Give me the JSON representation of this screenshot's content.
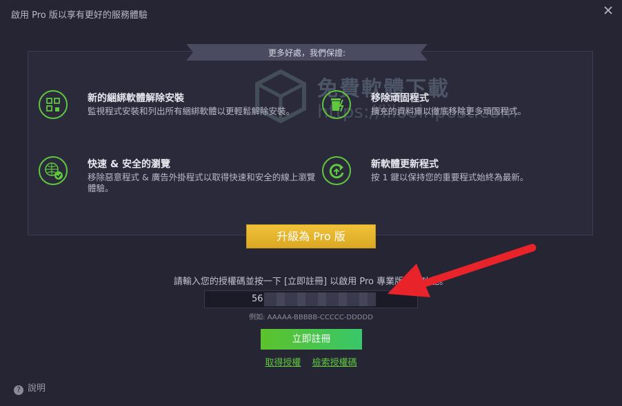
{
  "window": {
    "title": "啟用 Pro 版以享有更好的服務體驗",
    "close_icon": "close-icon"
  },
  "panel": {
    "ribbon": "更多好處，我們保證:",
    "features": [
      {
        "icon": "uninstall-bundle-icon",
        "title": "新的綑綁軟體解除安裝",
        "desc": "監視程式安裝和列出所有綑綁軟體以更輕鬆解除安裝。"
      },
      {
        "icon": "trash-icon",
        "title": "移除頑固程式",
        "desc": "擴充的資料庫以徹底移除更多頑固程式。"
      },
      {
        "icon": "globe-check-icon",
        "title": "快速 & 安全的瀏覽",
        "desc": "移除惡意程式 & 廣告外掛程式以取得快速和安全的線上瀏覽體驗。"
      },
      {
        "icon": "refresh-icon",
        "title": "新軟體更新程式",
        "desc": "按 1 鍵以保持您的重要程式始終為最新。"
      }
    ]
  },
  "upgrade_button": "升級為 Pro 版",
  "license": {
    "prompt": "請輸入您的授權碼並按一下 [立即註冊] 以啟用 Pro 專業版全部功能。",
    "value": "56",
    "example": "例如: AAAAA-BBBBB-CCCCC-DDDDD"
  },
  "register_button": "立即註冊",
  "links": {
    "get_license": "取得授權",
    "find_license": "檢索授權碼"
  },
  "help": "說明",
  "colors": {
    "accent_green": "#5fc83f",
    "upgrade_yellow": "#e8b82e",
    "arrow_red": "#e8232a"
  }
}
